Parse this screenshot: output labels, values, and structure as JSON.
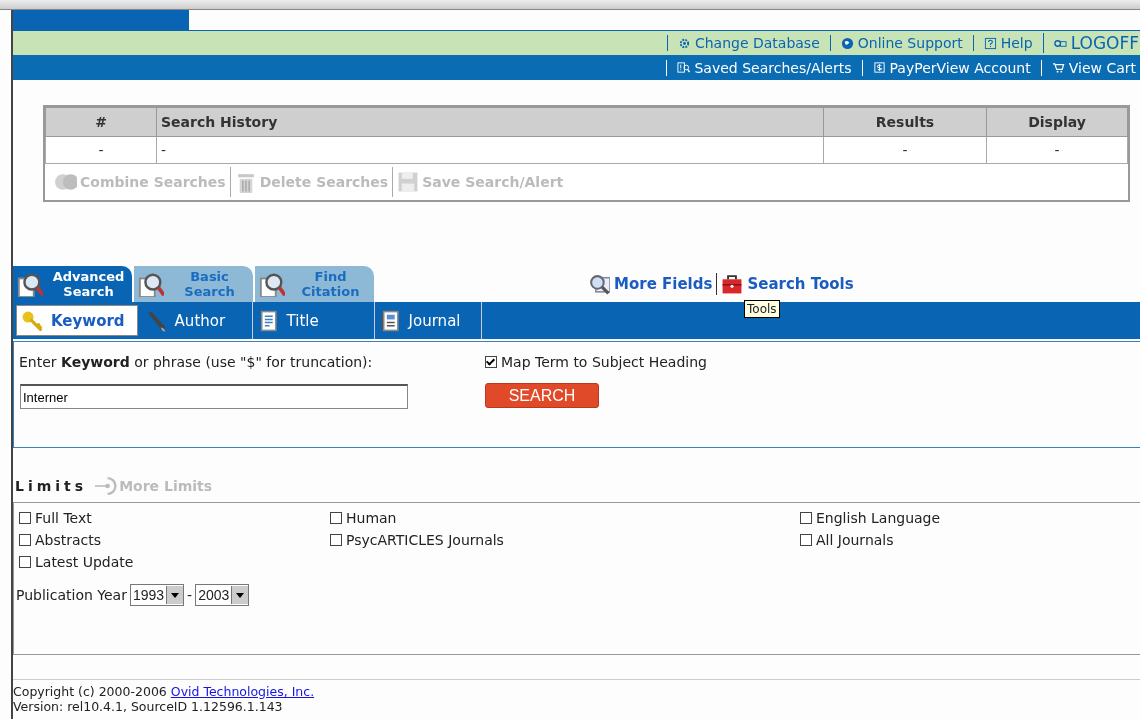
{
  "header": {
    "top_links": [
      {
        "kind": "gear",
        "label": "Change Database"
      },
      {
        "kind": "globe",
        "label": "Online Support"
      },
      {
        "kind": "help",
        "label": "Help"
      },
      {
        "kind": "key",
        "label": "LOGOFF"
      }
    ],
    "bottom_links": [
      {
        "kind": "saved",
        "label": "Saved Searches/Alerts"
      },
      {
        "kind": "dollar",
        "label": "PayPerView Account"
      },
      {
        "kind": "cart",
        "label": "View Cart"
      }
    ]
  },
  "search_history": {
    "columns": [
      "#",
      "Search History",
      "Results",
      "Display"
    ],
    "rows": [
      [
        "-",
        "-",
        "-",
        "-"
      ]
    ],
    "actions": [
      {
        "kind": "combine",
        "label": "Combine Searches",
        "disabled": true
      },
      {
        "kind": "trash",
        "label": "Delete Searches",
        "disabled": true
      },
      {
        "kind": "disk",
        "label": "Save Search/Alert",
        "disabled": true
      }
    ]
  },
  "tabs": [
    {
      "label": "Advanced Search",
      "selected": true
    },
    {
      "label": "Basic Search",
      "selected": false
    },
    {
      "label": "Find Citation",
      "selected": false
    }
  ],
  "tool_links": [
    {
      "kind": "fields",
      "label": "More Fields"
    },
    {
      "kind": "toolbox",
      "label": "Search Tools"
    }
  ],
  "tooltip": "Tools",
  "subtabs": [
    {
      "kind": "key",
      "label": "Keyword",
      "selected": true
    },
    {
      "kind": "pen",
      "label": "Author",
      "selected": false
    },
    {
      "kind": "page",
      "label": "Title",
      "selected": false
    },
    {
      "kind": "journal",
      "label": "Journal",
      "selected": false
    }
  ],
  "form": {
    "prompt": "Enter **Keyword** or phrase (use \"$\" for truncation):",
    "map_term": {
      "label": "Map Term to Subject Heading",
      "checked": true
    },
    "query": {
      "value": "Interner"
    },
    "button": "SEARCH"
  },
  "limits": {
    "title": "Limits",
    "more_limits": {
      "label": "More Limits",
      "disabled": true
    },
    "options": [
      {
        "label": "Full Text",
        "checked": false
      },
      {
        "label": "Human",
        "checked": false
      },
      {
        "label": "English Language",
        "checked": false
      },
      {
        "label": "Abstracts",
        "checked": false
      },
      {
        "label": "PsycARTICLES Journals",
        "checked": false
      },
      {
        "label": "All Journals",
        "checked": false
      },
      {
        "label": "Latest Update",
        "checked": false
      }
    ],
    "publication_year": {
      "label": "Publication Year",
      "from": "1993",
      "separator": "-",
      "to": "2003"
    }
  },
  "footer": {
    "copyright": "Copyright (c) 2000-2006",
    "company_link": "Ovid Technologies, Inc.",
    "version": "Version: rel10.4.1, SourceID 1.12596.1.143"
  }
}
